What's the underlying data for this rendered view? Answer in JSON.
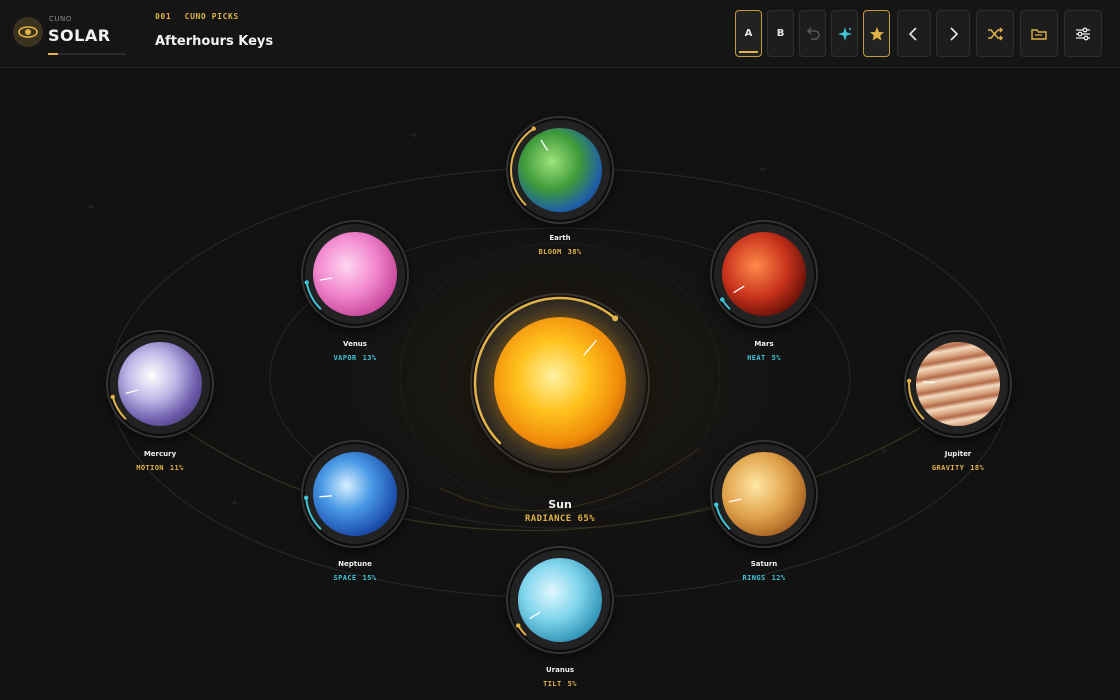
{
  "brand": {
    "small": "CUNO",
    "name": "SOLAR"
  },
  "preset": {
    "number": "001",
    "bank": "CUNO PICKS",
    "name": "Afterhours Keys"
  },
  "toolbar": {
    "a_label": "A",
    "b_label": "B",
    "icons": [
      "undo-icon",
      "sparkle-icon",
      "star-icon",
      "chevron-left-icon",
      "chevron-right-icon",
      "shuffle-icon",
      "folder-icon",
      "sliders-icon"
    ]
  },
  "colors": {
    "accent": "#e0b248",
    "cyan": "#3fc4d8",
    "bg": "#121212"
  },
  "planets": {
    "sun": {
      "name": "Sun",
      "param": "RADIANCE",
      "value": "65%",
      "level": 0.65,
      "color": "#e0b248"
    },
    "earth": {
      "name": "Earth",
      "param": "BLOOM",
      "value": "38%",
      "level": 0.38,
      "color": "#e0b248"
    },
    "venus": {
      "name": "Venus",
      "param": "VAPOR",
      "value": "13%",
      "level": 0.13,
      "color": "#3fc4d8"
    },
    "mars": {
      "name": "Mars",
      "param": "HEAT",
      "value": "5%",
      "level": 0.05,
      "color": "#3fc4d8"
    },
    "mercury": {
      "name": "Mercury",
      "param": "MOTION",
      "value": "11%",
      "level": 0.11,
      "color": "#e0b248"
    },
    "jupiter": {
      "name": "Jupiter",
      "param": "GRAVITY",
      "value": "18%",
      "level": 0.18,
      "color": "#e0b248"
    },
    "neptune": {
      "name": "Neptune",
      "param": "SPACE",
      "value": "15%",
      "level": 0.15,
      "color": "#3fc4d8"
    },
    "saturn": {
      "name": "Saturn",
      "param": "RINGS",
      "value": "12%",
      "level": 0.12,
      "color": "#3fc4d8"
    },
    "uranus": {
      "name": "Uranus",
      "param": "TILT",
      "value": "5%",
      "level": 0.05,
      "color": "#e0b248"
    }
  }
}
